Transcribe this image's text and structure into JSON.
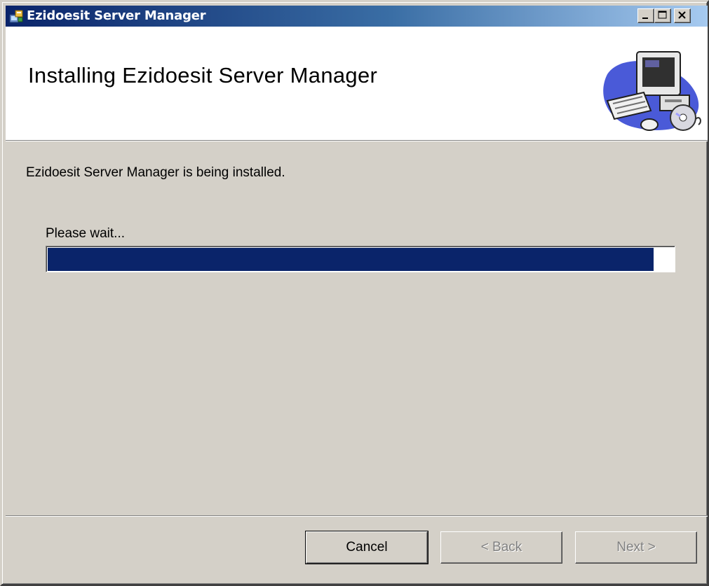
{
  "window": {
    "title": "Ezidoesit Server Manager",
    "controls": {
      "minimize": "minimize",
      "maximize": "maximize",
      "close": "close"
    }
  },
  "header": {
    "title": "Installing Ezidoesit Server Manager",
    "graphic": "computer-installer-icon"
  },
  "main": {
    "status_text": "Ezidoesit Server Manager is being installed.",
    "wait_label": "Please wait...",
    "progress_fraction": 0.966
  },
  "footer": {
    "cancel_label": "Cancel",
    "back_label": "< Back",
    "next_label": "Next >"
  },
  "colors": {
    "titlebar_start": "#0a246a",
    "titlebar_end": "#a6caf0",
    "progress_fill": "#0a246a",
    "dialog_face": "#d4d0c8"
  }
}
